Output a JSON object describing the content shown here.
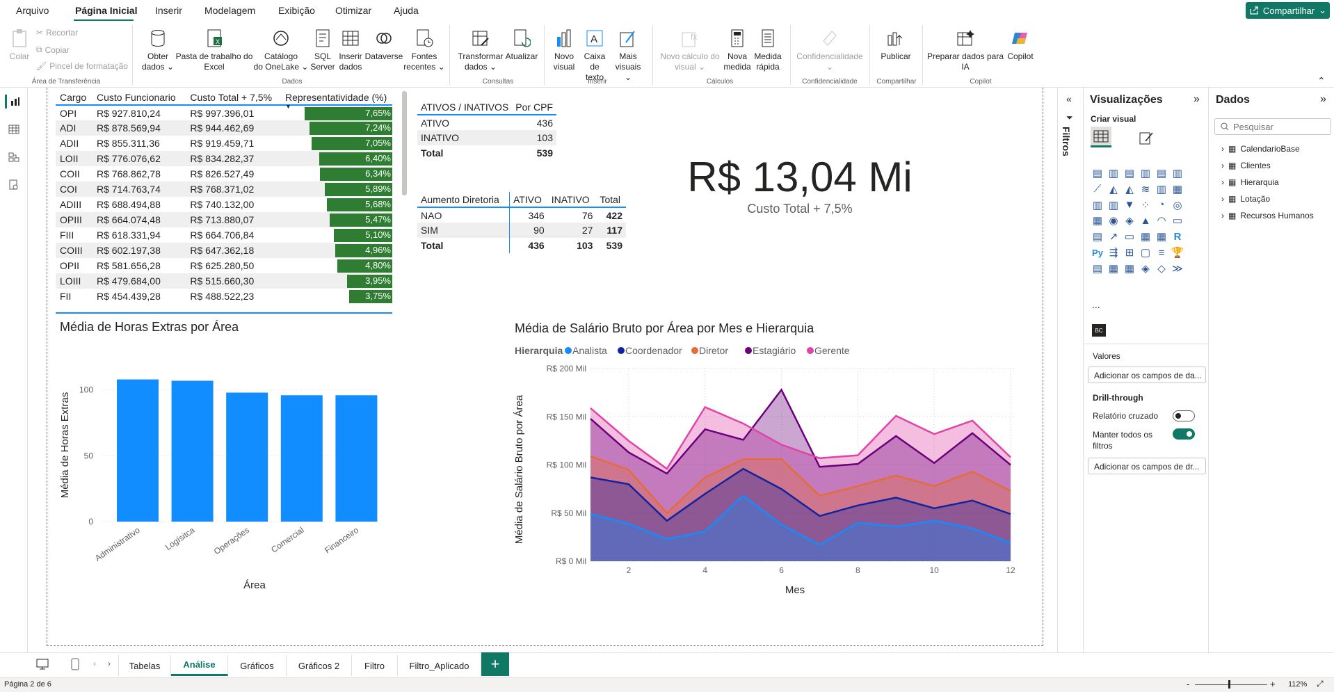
{
  "menu": {
    "items": [
      "Arquivo",
      "Página Inicial",
      "Inserir",
      "Modelagem",
      "Exibição",
      "Otimizar",
      "Ajuda"
    ],
    "active": "Página Inicial",
    "share_label": "Compartilhar"
  },
  "ribbon": {
    "clipboard": {
      "paste": "Colar",
      "cut": "Recortar",
      "copy": "Copiar",
      "format_painter": "Pincel de formatação",
      "group": "Área de Transferência"
    },
    "data": {
      "get_data_1": "Obter",
      "get_data_2": "dados",
      "excel_1": "Pasta de trabalho do",
      "excel_2": "Excel",
      "onelake_1": "Catálogo",
      "onelake_2": "do OneLake",
      "sql_1": "SQL",
      "sql_2": "Server",
      "enter_1": "Inserir",
      "enter_2": "dados",
      "dataverse": "Dataverse",
      "recent_1": "Fontes",
      "recent_2": "recentes",
      "group": "Dados"
    },
    "queries": {
      "transform_1": "Transformar",
      "transform_2": "dados",
      "refresh": "Atualizar",
      "group": "Consultas"
    },
    "insert": {
      "visual_1": "Novo",
      "visual_2": "visual",
      "textbox_1": "Caixa de",
      "textbox_2": "texto",
      "more_1": "Mais",
      "more_2": "visuais",
      "group": "Inserir"
    },
    "calc": {
      "newcalc_1": "Novo cálculo do",
      "newcalc_2": "visual",
      "measure_1": "Nova",
      "measure_2": "medida",
      "quick_1": "Medida",
      "quick_2": "rápida",
      "group": "Cálculos"
    },
    "sensitivity": {
      "label": "Confidencialidade",
      "group": "Confidencialidade"
    },
    "share": {
      "publish": "Publicar",
      "group": "Compartilhar"
    },
    "copilot": {
      "prep_1": "Preparar dados para",
      "prep_2": "IA",
      "copilot": "Copilot",
      "group": "Copilot"
    }
  },
  "table1": {
    "headers": [
      "Cargo",
      "Custo Funcionario",
      "Custo Total + 7,5%",
      "Representatividade (%)"
    ],
    "rows": [
      {
        "cargo": "OPI",
        "custo": "R$ 927.810,24",
        "total": "R$ 997.396,01",
        "rep": "7,65%",
        "pct": 7.65
      },
      {
        "cargo": "ADI",
        "custo": "R$ 878.569,94",
        "total": "R$ 944.462,69",
        "rep": "7,24%",
        "pct": 7.24
      },
      {
        "cargo": "ADII",
        "custo": "R$ 855.311,36",
        "total": "R$ 919.459,71",
        "rep": "7,05%",
        "pct": 7.05
      },
      {
        "cargo": "LOII",
        "custo": "R$ 776.076,62",
        "total": "R$ 834.282,37",
        "rep": "6,40%",
        "pct": 6.4
      },
      {
        "cargo": "COII",
        "custo": "R$ 768.862,78",
        "total": "R$ 826.527,49",
        "rep": "6,34%",
        "pct": 6.34
      },
      {
        "cargo": "COI",
        "custo": "R$ 714.763,74",
        "total": "R$ 768.371,02",
        "rep": "5,89%",
        "pct": 5.89
      },
      {
        "cargo": "ADIII",
        "custo": "R$ 688.494,88",
        "total": "R$ 740.132,00",
        "rep": "5,68%",
        "pct": 5.68
      },
      {
        "cargo": "OPIII",
        "custo": "R$ 664.074,48",
        "total": "R$ 713.880,07",
        "rep": "5,47%",
        "pct": 5.47
      },
      {
        "cargo": "FIII",
        "custo": "R$ 618.331,94",
        "total": "R$ 664.706,84",
        "rep": "5,10%",
        "pct": 5.1
      },
      {
        "cargo": "COIII",
        "custo": "R$ 602.197,38",
        "total": "R$ 647.362,18",
        "rep": "4,96%",
        "pct": 4.96
      },
      {
        "cargo": "OPII",
        "custo": "R$ 581.656,28",
        "total": "R$ 625.280,50",
        "rep": "4,80%",
        "pct": 4.8
      },
      {
        "cargo": "LOIII",
        "custo": "R$ 479.684,00",
        "total": "R$ 515.660,30",
        "rep": "3,95%",
        "pct": 3.95
      },
      {
        "cargo": "FII",
        "custo": "R$ 454.439,28",
        "total": "R$ 488.522,23",
        "rep": "3,75%",
        "pct": 3.75
      }
    ]
  },
  "table2": {
    "headers": [
      "ATIVOS / INATIVOS",
      "Por CPF"
    ],
    "rows": [
      [
        "ATIVO",
        "436"
      ],
      [
        "INATIVO",
        "103"
      ]
    ],
    "total": [
      "Total",
      "539"
    ]
  },
  "table3": {
    "headers": [
      "Aumento Diretoria",
      "ATIVO",
      "INATIVO",
      "Total"
    ],
    "rows": [
      [
        "NAO",
        "346",
        "76",
        "422"
      ],
      [
        "SIM",
        "90",
        "27",
        "117"
      ]
    ],
    "total": [
      "Total",
      "436",
      "103",
      "539"
    ]
  },
  "card": {
    "value": "R$ 13,04 Mi",
    "label": "Custo Total + 7,5%"
  },
  "chart_data": [
    {
      "type": "bar",
      "title": "Média de Horas Extras por Área",
      "xlabel": "Área",
      "ylabel": "Média de Horas Extras",
      "categories": [
        "Administrativo",
        "Logísitca",
        "Operações",
        "Comercial",
        "Financeiro"
      ],
      "values": [
        108,
        107,
        98,
        96,
        96
      ],
      "ylim": [
        0,
        112
      ],
      "yticks": [
        "0",
        "50",
        "100"
      ],
      "color": "#118dff",
      "grid": true
    },
    {
      "type": "area",
      "title": "Média de Salário Bruto por Área por Mes e Hierarquia",
      "xlabel": "Mes",
      "ylabel": "Média de Salário Bruto por Área",
      "legend_title": "Hierarquia",
      "legend_position": "top-left",
      "x": [
        1,
        2,
        3,
        4,
        5,
        6,
        7,
        8,
        9,
        10,
        11,
        12
      ],
      "xticks": [
        "2",
        "4",
        "6",
        "8",
        "10",
        "12"
      ],
      "yticks": [
        "R$ 0 Mil",
        "R$ 50 Mil",
        "R$ 100 Mil",
        "R$ 150 Mil",
        "R$ 200 Mil"
      ],
      "ylim": [
        0,
        200
      ],
      "series": [
        {
          "name": "Analista",
          "color": "#118dff",
          "values": [
            49,
            39,
            23,
            31,
            68,
            38,
            17,
            40,
            36,
            42,
            34,
            19
          ]
        },
        {
          "name": "Coordenador",
          "color": "#12239e",
          "values": [
            87,
            80,
            42,
            70,
            96,
            75,
            47,
            58,
            66,
            55,
            63,
            49
          ]
        },
        {
          "name": "Diretor",
          "color": "#e66c37",
          "values": [
            109,
            95,
            50,
            87,
            106,
            106,
            68,
            78,
            89,
            78,
            93,
            73
          ]
        },
        {
          "name": "Estagiário",
          "color": "#6b007b",
          "values": [
            148,
            113,
            91,
            137,
            126,
            178,
            98,
            101,
            130,
            102,
            133,
            100
          ]
        },
        {
          "name": "Gerente",
          "color": "#e044a7",
          "values": [
            159,
            125,
            96,
            160,
            143,
            121,
            107,
            110,
            151,
            132,
            146,
            108
          ]
        }
      ]
    }
  ],
  "filters": {
    "label": "Filtros"
  },
  "viz_pane": {
    "title": "Visualizações",
    "build_label": "Criar visual",
    "values_label": "Valores",
    "values_placeholder": "Adicionar os campos de da...",
    "drill_label": "Drill-through",
    "cross_report": "Relatório cruzado",
    "keep_filters_1": "Manter todos os",
    "keep_filters_2": "filtros",
    "drill_placeholder": "Adicionar os campos de dr...",
    "ellipsis": "..."
  },
  "data_pane": {
    "title": "Dados",
    "search_placeholder": "Pesquisar",
    "tables": [
      "CalendarioBase",
      "Clientes",
      "Hierarquia",
      "Lotação",
      "Recursos Humanos"
    ]
  },
  "tabs": [
    "Tabelas",
    "Análise",
    "Gráficos",
    "Gráficos 2",
    "Filtro",
    "Filtro_Aplicado"
  ],
  "active_tab": "Análise",
  "status": {
    "page": "Página 2 de 6",
    "zoom": "112%",
    "zoom_minus": "-",
    "zoom_plus": "+"
  }
}
